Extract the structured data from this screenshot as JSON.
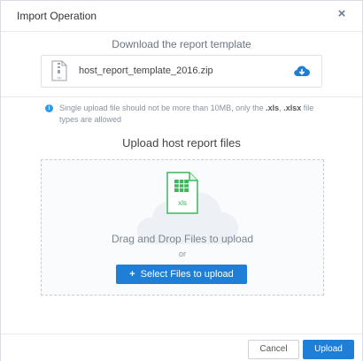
{
  "dialog": {
    "title": "Import Operation",
    "close_icon": "close-icon"
  },
  "download": {
    "title": "Download the report template",
    "file_name": "host_report_template_2016.zip",
    "file_icon": "zip-file-icon",
    "download_icon": "cloud-download-icon"
  },
  "note": {
    "icon": "info-icon",
    "text_before": "Single upload file should not be more than 10MB, only the ",
    "ext1": ".xls",
    "sep": ", ",
    "ext2": ".xlsx",
    "text_after": " file types are allowed"
  },
  "upload": {
    "title": "Upload host report files",
    "xls_label": "xls",
    "drag_text": "Drag and Drop Files to upload",
    "or_text": "or",
    "select_button": "Select Files to upload"
  },
  "footer": {
    "cancel_label": "Cancel",
    "upload_label": "Upload"
  },
  "colors": {
    "accent": "#1f7ed6",
    "info": "#2f9be6",
    "xls_green": "#3fb55e"
  }
}
